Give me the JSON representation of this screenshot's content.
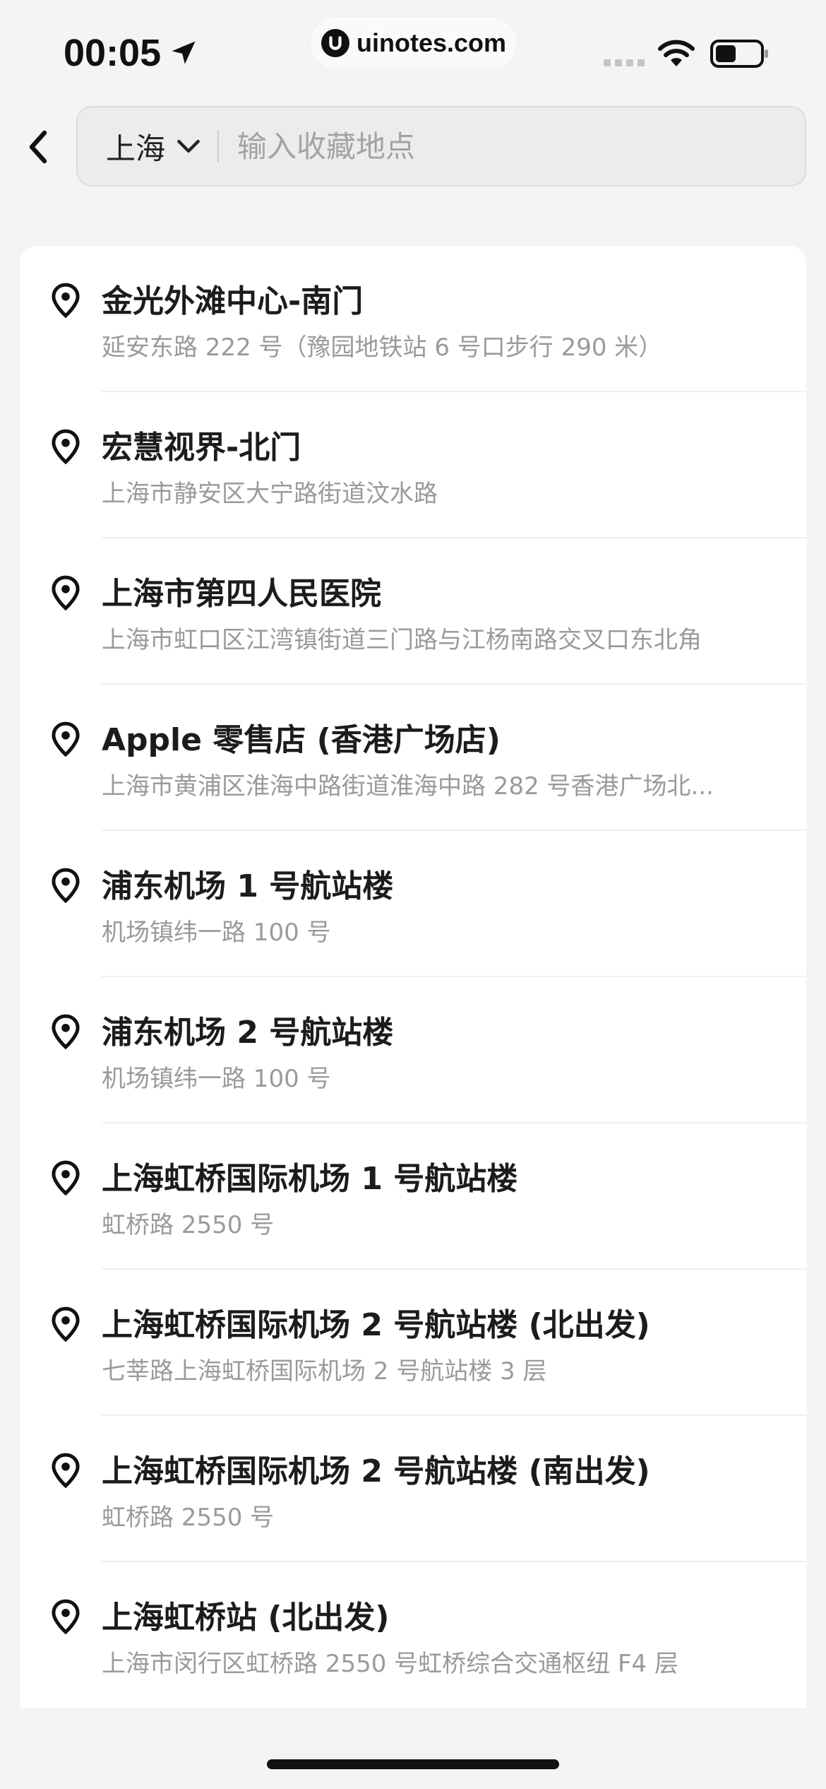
{
  "status_bar": {
    "time": "00:05",
    "watermark": "uinotes.com"
  },
  "search": {
    "city": "上海",
    "placeholder": "输入收藏地点",
    "value": ""
  },
  "results": [
    {
      "name": "金光外滩中心-南门",
      "address": "延安东路 222 号（豫园地铁站 6 号口步行 290 米）"
    },
    {
      "name": "宏慧视界-北门",
      "address": "上海市静安区大宁路街道汶水路"
    },
    {
      "name": "上海市第四人民医院",
      "address": "上海市虹口区江湾镇街道三门路与江杨南路交叉口东北角"
    },
    {
      "name": "Apple 零售店 (香港广场店)",
      "address": "上海市黄浦区淮海中路街道淮海中路 282 号香港广场北..."
    },
    {
      "name": "浦东机场 1 号航站楼",
      "address": "机场镇纬一路 100 号"
    },
    {
      "name": "浦东机场 2 号航站楼",
      "address": "机场镇纬一路 100 号"
    },
    {
      "name": "上海虹桥国际机场 1 号航站楼",
      "address": "虹桥路 2550 号"
    },
    {
      "name": "上海虹桥国际机场 2 号航站楼 (北出发)",
      "address": "七莘路上海虹桥国际机场 2 号航站楼 3 层"
    },
    {
      "name": "上海虹桥国际机场 2 号航站楼 (南出发)",
      "address": "虹桥路 2550 号"
    },
    {
      "name": "上海虹桥站 (北出发)",
      "address": "上海市闵行区虹桥路 2550 号虹桥综合交通枢纽 F4 层"
    }
  ],
  "icons": {
    "pin": "location-pin-icon",
    "back": "chevron-left-icon",
    "city_dropdown": "chevron-down-icon"
  }
}
